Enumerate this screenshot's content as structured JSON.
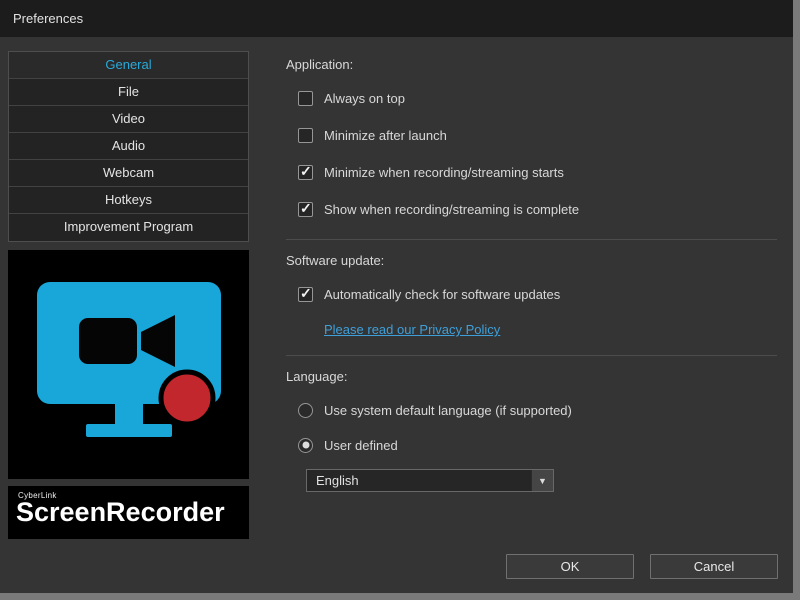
{
  "window": {
    "title": "Preferences"
  },
  "icons": {
    "chevron_down": "▼"
  },
  "sidebar": {
    "items": [
      {
        "label": "General",
        "selected": true
      },
      {
        "label": "File",
        "selected": false
      },
      {
        "label": "Video",
        "selected": false
      },
      {
        "label": "Audio",
        "selected": false
      },
      {
        "label": "Webcam",
        "selected": false
      },
      {
        "label": "Hotkeys",
        "selected": false
      },
      {
        "label": "Improvement Program",
        "selected": false
      }
    ],
    "logo": {
      "brand": "CyberLink",
      "product": "ScreenRecorder"
    }
  },
  "application": {
    "heading": "Application:",
    "checkboxes": [
      {
        "label": "Always on top",
        "checked": false
      },
      {
        "label": "Minimize after launch",
        "checked": false
      },
      {
        "label": "Minimize when recording/streaming starts",
        "checked": true
      },
      {
        "label": "Show when recording/streaming is complete",
        "checked": true
      }
    ]
  },
  "software_update": {
    "heading": "Software update:",
    "checkboxes": [
      {
        "label": "Automatically check for software updates",
        "checked": true
      }
    ],
    "privacy_link": "Please read our Privacy Policy"
  },
  "language": {
    "heading": "Language:",
    "radios": [
      {
        "label": "Use system default language (if supported)",
        "selected": false
      },
      {
        "label": "User defined",
        "selected": true
      }
    ],
    "dropdown_value": "English"
  },
  "footer": {
    "ok_label": "OK",
    "cancel_label": "Cancel"
  },
  "colors": {
    "accent": "#29a9d9",
    "link": "#3f9fd9",
    "logo_cyan": "#18a7d8",
    "record_red": "#c1272d"
  }
}
